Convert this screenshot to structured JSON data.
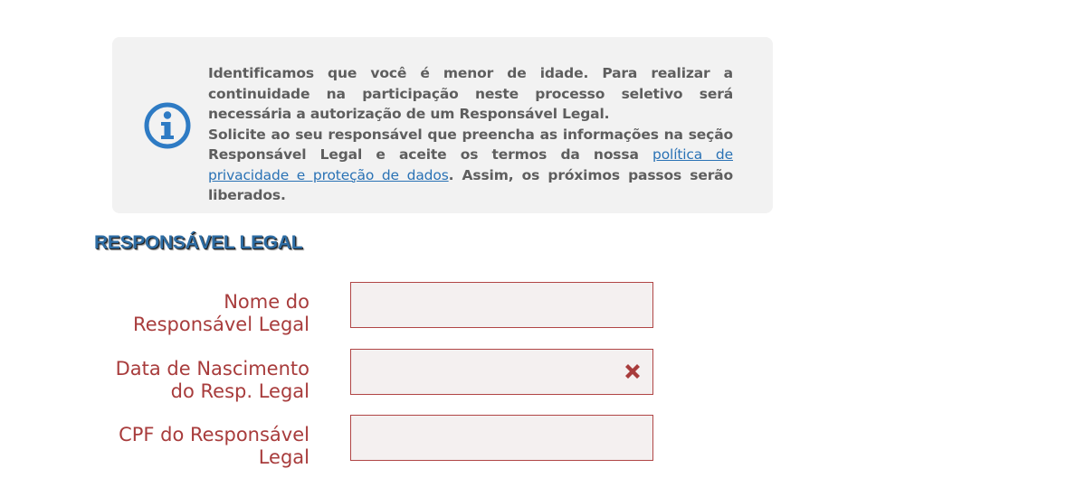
{
  "notice": {
    "paragraph1": "Identificamos que você é menor de idade. Para realizar a continuidade na participação neste processo seletivo será necessária a autorização de um Responsável Legal.",
    "paragraph2_before": "Solicite ao seu responsável que preencha as informações na seção Responsável Legal e aceite os termos da nossa ",
    "paragraph2_link": "política de privacidade e proteção de dados",
    "paragraph2_after": ". Assim, os próximos passos serão liberados.",
    "icon": "info-icon"
  },
  "section": {
    "title": "RESPONSÁVEL LEGAL"
  },
  "form": {
    "fields": [
      {
        "label_line1": "Nome do",
        "label_line2": "Responsável Legal",
        "value": ""
      },
      {
        "label_line1": "Data de Nascimento",
        "label_line2": "do Resp. Legal",
        "value": "",
        "clear_icon": "close-x-icon"
      },
      {
        "label_line1": "CPF do Responsável",
        "label_line2": "Legal",
        "value": ""
      }
    ]
  },
  "colors": {
    "notice_bg": "#f2f2f2",
    "notice_text": "#5e5e5e",
    "link": "#2a72b5",
    "title": "#2e6da4",
    "label": "#a83c3c",
    "input_border": "#b04545",
    "input_bg": "#f4f0f0"
  }
}
